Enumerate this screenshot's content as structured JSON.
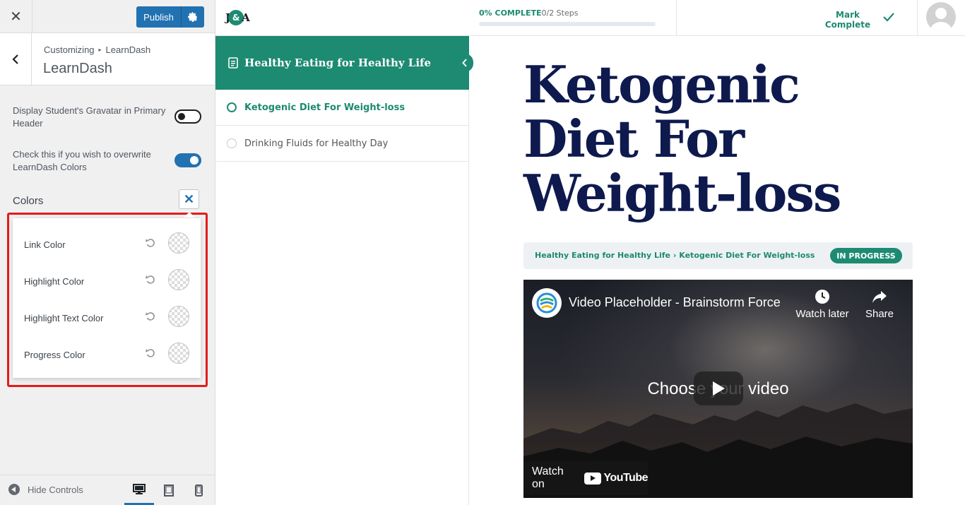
{
  "customizer": {
    "close_icon": "close-icon",
    "publish_label": "Publish",
    "publish_settings_icon": "gear-icon",
    "back_icon": "chevron-left-icon",
    "breadcrumb_root": "Customizing",
    "breadcrumb_current": "LearnDash",
    "section_title": "LearnDash",
    "options": [
      {
        "label": "Display Student's Gravatar in Primary Header",
        "enabled": false
      },
      {
        "label": "Check this if you wish to overwrite LearnDash Colors",
        "enabled": true
      }
    ],
    "colors": {
      "heading": "Colors",
      "close_icon": "close-icon",
      "reset_icon": "undo-icon",
      "items": [
        {
          "label": "Link Color",
          "value": ""
        },
        {
          "label": "Highlight Color",
          "value": ""
        },
        {
          "label": "Highlight Text Color",
          "value": ""
        },
        {
          "label": "Progress Color",
          "value": ""
        }
      ]
    },
    "footer": {
      "hide_controls_label": "Hide Controls",
      "devices": [
        "desktop",
        "tablet",
        "mobile"
      ],
      "active_device": "desktop"
    }
  },
  "preview": {
    "logo": {
      "left": "J",
      "middle": "&",
      "right": "A"
    },
    "progress": {
      "percent_label": "0% COMPLETE",
      "steps_label": "0/2 Steps",
      "fraction": 0
    },
    "mark_complete_label": "Mark Complete",
    "mark_complete_icon": "checkmark-icon",
    "avatar_icon": "user-avatar-icon",
    "course_title": "Healthy Eating for Healthy Life",
    "course_icon": "document-icon",
    "lessons": [
      {
        "title": "Ketogenic Diet For Weight-loss",
        "current": true
      },
      {
        "title": "Drinking Fluids for Healthy Day",
        "current": false
      }
    ],
    "lesson_title": "Ketogenic Diet For Weight-loss",
    "breadcrumb": {
      "course": "Healthy Eating for Healthy Life",
      "separator": "›",
      "lesson": "Ketogenic Diet For Weight-loss"
    },
    "status_badge": "IN PROGRESS",
    "video": {
      "title": "Video Placeholder - Brainstorm Force",
      "watch_later_label": "Watch later",
      "share_label": "Share",
      "center_text": "Choose your video",
      "watch_on_label": "Watch on",
      "youtube_wordmark": "YouTube"
    }
  },
  "colors": {
    "accent_blue": "#2271b1",
    "brand_green": "#1d8a72",
    "title_navy": "#0e1a4e",
    "highlight_red": "#e31b1b"
  }
}
